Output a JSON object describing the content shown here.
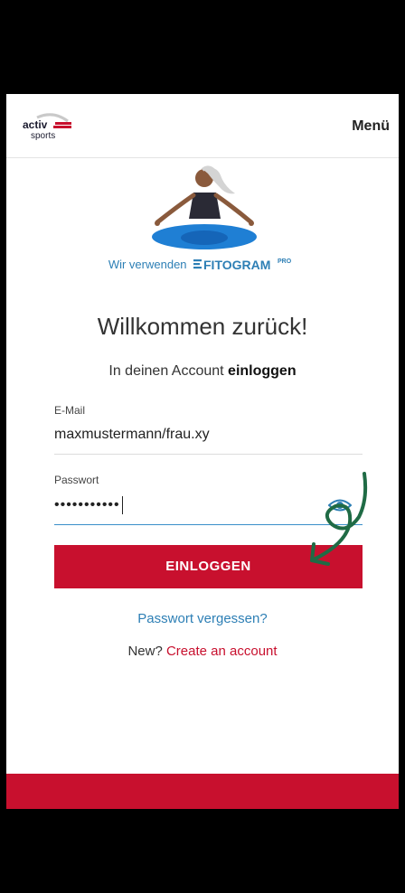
{
  "header": {
    "logo_top": "activ",
    "logo_bottom": "sports",
    "menu_label": "Menü"
  },
  "promo": {
    "prefix": "Wir verwenden",
    "brand": "FITOGRAM",
    "brand_suffix": "PRO"
  },
  "login": {
    "title": "Willkommen zurück!",
    "subtitle_prefix": "In deinen Account",
    "subtitle_bold": "einloggen",
    "email_label": "E-Mail",
    "email_value": "maxmustermann/frau.xy",
    "password_label": "Passwort",
    "password_value": "•••••••••••",
    "button_label": "EINLOGGEN",
    "forgot_label": "Passwort vergessen?",
    "signup_prefix": "New?",
    "signup_link": "Create an account"
  },
  "colors": {
    "brand_red": "#c8102e",
    "link_blue": "#2d7fb5",
    "annotation_green": "#1f6b45"
  },
  "icons": {
    "password_toggle": "eye-icon",
    "annotation": "hand-drawn-arrow"
  }
}
